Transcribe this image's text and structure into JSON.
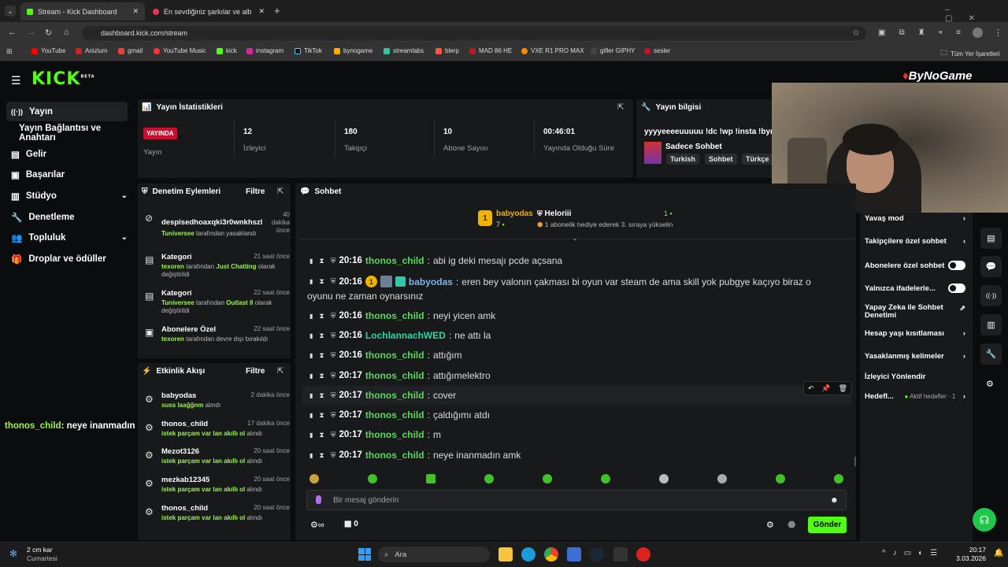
{
  "browser": {
    "tabs": [
      {
        "label": "Stream - Kick Dashboard"
      },
      {
        "label": "En sevdiğiniz şarkılar ve albüml"
      }
    ],
    "url": "dashboard.kick.com/stream",
    "bookmarks": [
      "YouTube",
      "Anizium",
      "gmail",
      "YouTube Music",
      "kick",
      "instagram",
      "TikTok",
      "bynogame",
      "streamlabs",
      "blerp",
      "MAD 86 HE",
      "VXE R1 PRO MAX",
      "gifler GIPHY",
      "sesler"
    ],
    "all_bookmarks": "Tüm Yer İşaretleri"
  },
  "kick": {
    "logo": "KICK",
    "logo_sup": "BETA"
  },
  "sidebar": {
    "items": [
      {
        "label": "Yayın",
        "icon": "stream-icon"
      },
      {
        "label": "Yayın Bağlantısı ve Anahtarı",
        "icon": ""
      },
      {
        "label": "Gelir",
        "icon": "money-icon"
      },
      {
        "label": "Başarılar",
        "icon": "trophy-icon"
      },
      {
        "label": "Stüdyo",
        "icon": "studio-icon"
      },
      {
        "label": "Denetleme",
        "icon": "wrench-icon"
      },
      {
        "label": "Topluluk",
        "icon": "people-icon"
      },
      {
        "label": "Droplar ve ödüller",
        "icon": "gift-icon"
      }
    ]
  },
  "stats": {
    "title": "Yayın İstatistikleri",
    "live_badge": "YAYINDA",
    "live_label": "Yayın",
    "items": [
      {
        "value": "12",
        "label": "İzleyici"
      },
      {
        "value": "180",
        "label": "Takipçi"
      },
      {
        "value": "10",
        "label": "Abone Sayısı"
      },
      {
        "value": "00:46:01",
        "label": "Yayında Olduğu Süre"
      }
    ]
  },
  "info": {
    "title": "Yayın bilgisi",
    "stream_title": "yyyyeeeeuuuuu !dc !wp !insta !byno",
    "category": "Sadece Sohbet",
    "tags": [
      "Turkish",
      "Sohbet",
      "Türkçe"
    ]
  },
  "mod": {
    "title": "Denetim Eylemleri",
    "filter": "Filtre",
    "rows": [
      {
        "title": "despisedhoaxqki3r0wnkhszl",
        "time": "40 dakika önce",
        "actor": "Tuniversee",
        "desc": "tarafından yasaklandı"
      },
      {
        "title": "Kategori",
        "time": "21 saat önce",
        "actor": "texoren",
        "desc": "tarafından",
        "extra": "Just Chatting",
        "desc2": "olarak değiştirildi"
      },
      {
        "title": "Kategori",
        "time": "22 saat önce",
        "actor": "Tuniversee",
        "desc": "tarafından",
        "extra": "Outlast II",
        "desc2": "olarak değiştirildi"
      },
      {
        "title": "Abonelere Özel",
        "time": "22 saat önce",
        "actor": "texoren",
        "desc": "tarafından devre dışı bırakıldı"
      }
    ]
  },
  "activity": {
    "title": "Etkinlik Akışı",
    "filter": "Filtre",
    "rows": [
      {
        "name": "babyodas",
        "time": "2 dakika önce",
        "reward": "suss laağğnm",
        "suffix": "alındı"
      },
      {
        "name": "thonos_child",
        "time": "17 dakika önce",
        "reward": "istek parçam var lan akıllı ol",
        "suffix": "alındı"
      },
      {
        "name": "Mezot3126",
        "time": "20 saat önce",
        "reward": "istek parçam var lan akıllı ol",
        "suffix": "alındı"
      },
      {
        "name": "mezkab12345",
        "time": "20 saat önce",
        "reward": "istek parçam var lan akıllı ol",
        "suffix": "alındı"
      },
      {
        "name": "thonos_child",
        "time": "20 saat önce",
        "reward": "istek parçam var lan akıllı ol",
        "suffix": "alındı"
      }
    ]
  },
  "overlay": {
    "user": "thonos_child",
    "text": ": neye inanmadın amk"
  },
  "chat": {
    "title": "Sohbet",
    "pinned": {
      "gifter": "babyodas",
      "gifter_count": "7",
      "receiver": "Heloriii",
      "receiver_count": "1",
      "desc": "1 abonelik hediye ederek 3. sıraya yükselin"
    },
    "messages": [
      {
        "time": "20:16",
        "user": "thonos_child",
        "color": "#5bd85b",
        "text": "abi ig deki mesajı pcde açsana"
      },
      {
        "time": "20:16",
        "user": "babyodas",
        "color": "#7fb4e8",
        "text": "eren bey valonın çakması bi oyun var steam de ama skill yok pubgye kaçıyo biraz o",
        "text2": "oyunu ne zaman oynarsınız"
      },
      {
        "time": "20:16",
        "user": "thonos_child",
        "color": "#5bd85b",
        "text": "neyi yicen amk"
      },
      {
        "time": "20:16",
        "user": "LochlannachWED",
        "color": "#33d3a0",
        "text": "ne attı la"
      },
      {
        "time": "20:16",
        "user": "thonos_child",
        "color": "#5bd85b",
        "text": "attığım"
      },
      {
        "time": "20:17",
        "user": "thonos_child",
        "color": "#5bd85b",
        "text": "attığımelektro"
      },
      {
        "time": "20:17",
        "user": "thonos_child",
        "color": "#5bd85b",
        "text": "cover"
      },
      {
        "time": "20:17",
        "user": "thonos_child",
        "color": "#5bd85b",
        "text": "çaldığımı atdı"
      },
      {
        "time": "20:17",
        "user": "thonos_child",
        "color": "#5bd85b",
        "text": "m"
      },
      {
        "time": "20:17",
        "user": "thonos_child",
        "color": "#5bd85b",
        "text": "neye inanmadın amk"
      }
    ],
    "input_placeholder": "Bir mesaj gönderin",
    "points": "0",
    "send": "Gönder"
  },
  "settings": {
    "items": [
      {
        "label": "Yavaş mod",
        "control": "arrow"
      },
      {
        "label": "Takipçilere özel sohbet",
        "control": "arrow"
      },
      {
        "label": "Abonelere özel sohbet",
        "control": "toggle"
      },
      {
        "label": "Yalnızca ifadelerle...",
        "control": "toggle"
      },
      {
        "label": "Yapay Zeka ile Sohbet Denetimi",
        "control": "ext"
      },
      {
        "label": "Hesap yaşı kısıtlaması",
        "control": "arrow"
      },
      {
        "label": "Yasaklanmış kelimeler",
        "control": "arrow"
      },
      {
        "label": "İzleyici Yönlendir",
        "control": "none"
      },
      {
        "label": "Hedefl...",
        "control": "arrow",
        "note": "Aktif hedefler · 1"
      }
    ]
  },
  "webcam": {
    "brand": "ByNoGame"
  },
  "taskbar": {
    "weather": "2 cm kar",
    "day": "Cumartesi",
    "search": "Ara",
    "time": "20:17",
    "date": "3.03.2026"
  }
}
